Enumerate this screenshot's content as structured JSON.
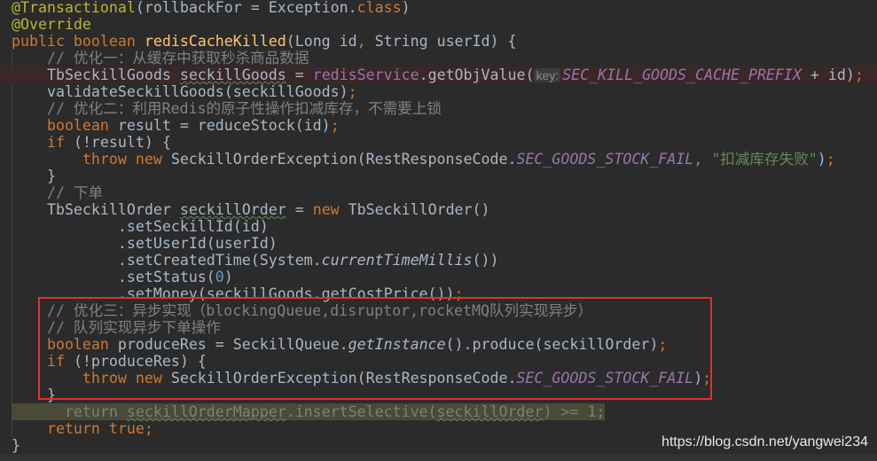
{
  "code_lines": [
    {
      "tokens": [
        [
          "ann",
          "@Transactional"
        ],
        [
          "",
          "(rollbackFor = Exception."
        ],
        [
          "kw",
          "class"
        ],
        [
          "",
          ")"
        ]
      ]
    },
    {
      "tokens": [
        [
          "ann",
          "@Override"
        ]
      ]
    },
    {
      "tokens": [
        [
          "kw",
          "public boolean "
        ],
        [
          "fn",
          "redisCacheKilled"
        ],
        [
          "",
          "(Long id"
        ],
        [
          "kw",
          ", "
        ],
        [
          "",
          "String userId) {"
        ]
      ]
    },
    {
      "tokens": [
        [
          "cm",
          "    // 优化一：从缓存中获取秒杀商品数据"
        ]
      ]
    },
    {
      "state": "error",
      "tokens": [
        [
          "",
          "    TbSeckillGoods "
        ],
        [
          "sq",
          "seckillGoods"
        ],
        [
          "",
          " = "
        ],
        [
          "field",
          "redisService"
        ],
        [
          "",
          ".getObjValue("
        ],
        [
          "hint",
          "key:"
        ],
        [
          "const",
          "SEC_KILL_GOODS_CACHE_PREFIX"
        ],
        [
          "",
          " + id)"
        ],
        [
          "kw",
          ";"
        ]
      ]
    },
    {
      "tokens": [
        [
          "",
          "    validateSeckillGoods(seckillGoods)"
        ],
        [
          "kw",
          ";"
        ]
      ]
    },
    {
      "tokens": [
        [
          "cm",
          "    // 优化二：利用Redis的原子性操作扣减库存，不需要上锁"
        ]
      ]
    },
    {
      "tokens": [
        [
          "kw",
          "    boolean "
        ],
        [
          "",
          "result = reduceStock(id)"
        ],
        [
          "kw",
          ";"
        ]
      ]
    },
    {
      "tokens": [
        [
          "kw",
          "    if "
        ],
        [
          "",
          "(!result) {"
        ]
      ]
    },
    {
      "tokens": [
        [
          "kw",
          "        throw new "
        ],
        [
          "",
          "SeckillOrderException(RestResponseCode."
        ],
        [
          "const",
          "SEC_GOODS_STOCK_FAIL"
        ],
        [
          "kw",
          ", "
        ],
        [
          "str",
          "\"扣减库存失败\""
        ],
        [
          "",
          ")"
        ],
        [
          "kw",
          ";"
        ]
      ]
    },
    {
      "tokens": [
        [
          "",
          "    }"
        ]
      ]
    },
    {
      "tokens": [
        [
          "cm",
          "    // 下单"
        ]
      ]
    },
    {
      "tokens": [
        [
          "",
          "    TbSeckillOrder "
        ],
        [
          "sq",
          "seckillOrder"
        ],
        [
          "",
          " = "
        ],
        [
          "kw",
          "new "
        ],
        [
          "",
          "TbSeckillOrder()"
        ]
      ]
    },
    {
      "tokens": [
        [
          "",
          "            .setSeckillId(id)"
        ]
      ]
    },
    {
      "tokens": [
        [
          "",
          "            .setUserId(userId)"
        ]
      ]
    },
    {
      "tokens": [
        [
          "",
          "            .setCreatedTime(System."
        ],
        [
          "it",
          "currentTimeMillis"
        ],
        [
          "",
          "())"
        ]
      ]
    },
    {
      "tokens": [
        [
          "",
          "            .setStatus("
        ],
        [
          "num",
          "0"
        ],
        [
          "",
          ")"
        ]
      ]
    },
    {
      "tokens": [
        [
          "",
          "            .setMoney(seckillGoods.getCostPrice())"
        ],
        [
          "kw",
          ";"
        ]
      ]
    },
    {
      "tokens": [
        [
          "cm",
          "    // 优化三：异步实现（blockingQueue,disruptor,rocketMQ队列实现异步）"
        ]
      ]
    },
    {
      "tokens": [
        [
          "cm",
          "    // 队列实现异步下单操作"
        ]
      ]
    },
    {
      "tokens": [
        [
          "kw",
          "    boolean "
        ],
        [
          "",
          "produceRes = SeckillQueue."
        ],
        [
          "it",
          "getInstance"
        ],
        [
          "",
          "().produce(seckillOrder)"
        ],
        [
          "kw",
          ";"
        ]
      ]
    },
    {
      "tokens": [
        [
          "kw",
          "    if "
        ],
        [
          "",
          "(!produceRes) {"
        ]
      ]
    },
    {
      "tokens": [
        [
          "kw",
          "        throw new "
        ],
        [
          "",
          "SeckillOrderException(RestResponseCode."
        ],
        [
          "const",
          "SEC_GOODS_STOCK_FAIL"
        ],
        [
          "",
          ")"
        ],
        [
          "kw",
          ";"
        ]
      ]
    },
    {
      "tokens": [
        [
          "",
          "    }"
        ]
      ]
    },
    {
      "state": "dimmed",
      "tokens": [
        [
          "dimt",
          "      return "
        ],
        [
          "sq",
          "seckillOrderMapper"
        ],
        [
          "dimt",
          ".insertSelective("
        ],
        [
          "sq",
          "seckillOrder"
        ],
        [
          "dimt",
          ") >= 1;"
        ]
      ]
    },
    {
      "tokens": [
        [
          "kw",
          "    return true;"
        ]
      ]
    },
    {
      "tokens": [
        [
          "",
          "}"
        ]
      ]
    }
  ],
  "highlight_box": {
    "color": "#e0322c",
    "first_line": 19,
    "last_line": 24
  },
  "watermark": "https://blog.csdn.net/yangwei234",
  "colors": {
    "background": "#2b2b2b",
    "keyword": "#cc7832",
    "annotation": "#bbb529",
    "method_decl": "#ffc66d",
    "comment": "#808080",
    "string": "#6a8759",
    "constant": "#9876aa",
    "number": "#6897bb",
    "text": "#a9b7c6"
  }
}
